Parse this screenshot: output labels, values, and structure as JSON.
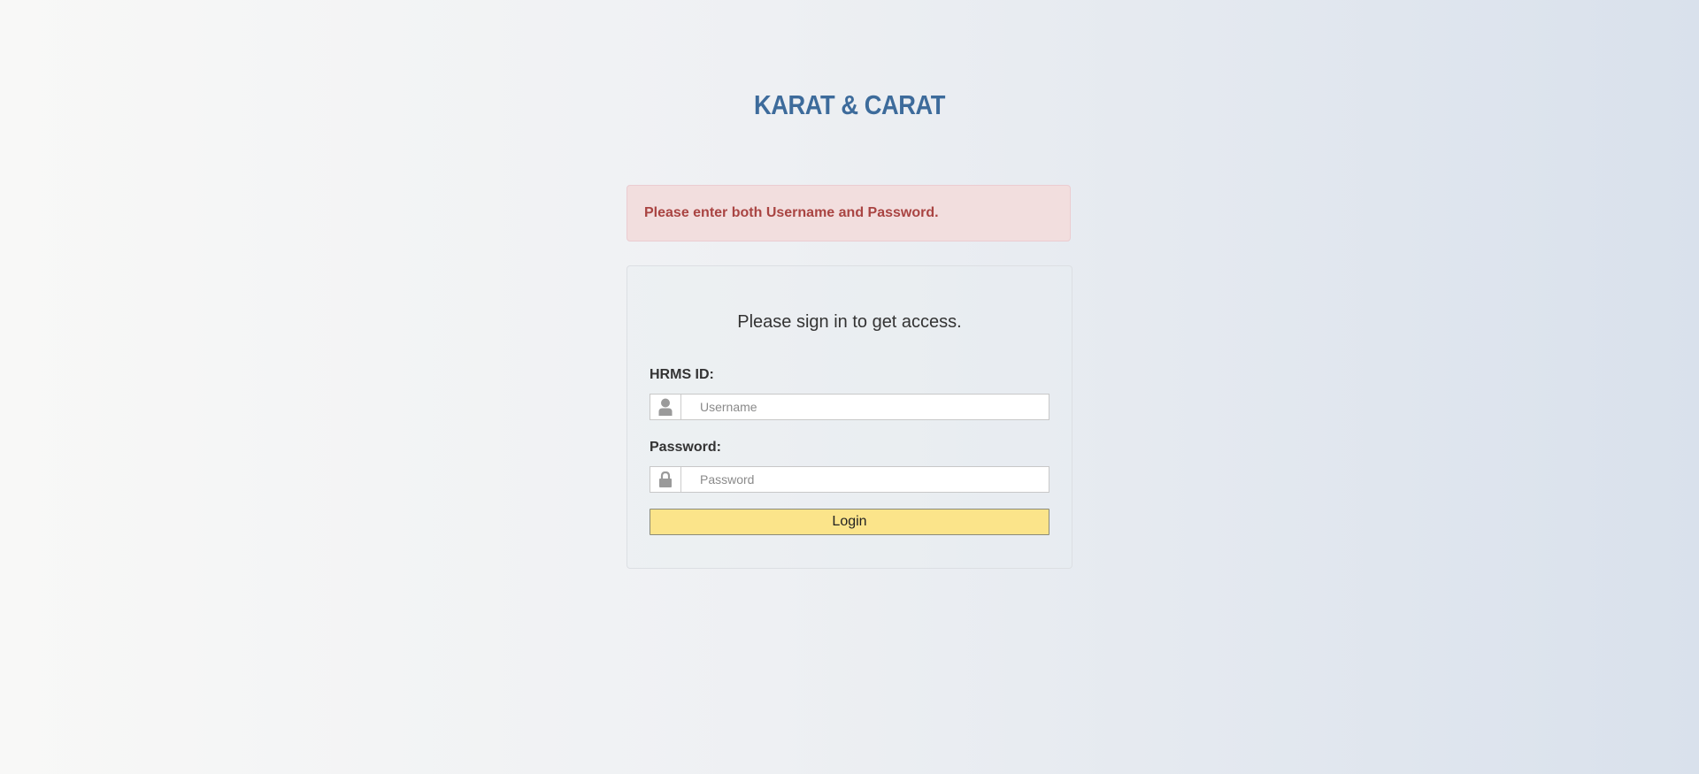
{
  "brand": {
    "title": "KARAT & CARAT"
  },
  "alert": {
    "message": "Please enter both Username and Password."
  },
  "login_form": {
    "subtitle": "Please sign in to get access.",
    "username": {
      "label": "HRMS ID:",
      "placeholder": "Username",
      "value": "",
      "icon": "user-icon"
    },
    "password": {
      "label": "Password:",
      "placeholder": "Password",
      "value": "",
      "icon": "lock-icon"
    },
    "submit_label": "Login"
  },
  "colors": {
    "brand": "#3d6b9b",
    "alert_background": "#f2dede",
    "alert_text": "#a94442",
    "button_background": "#fbe48a"
  }
}
